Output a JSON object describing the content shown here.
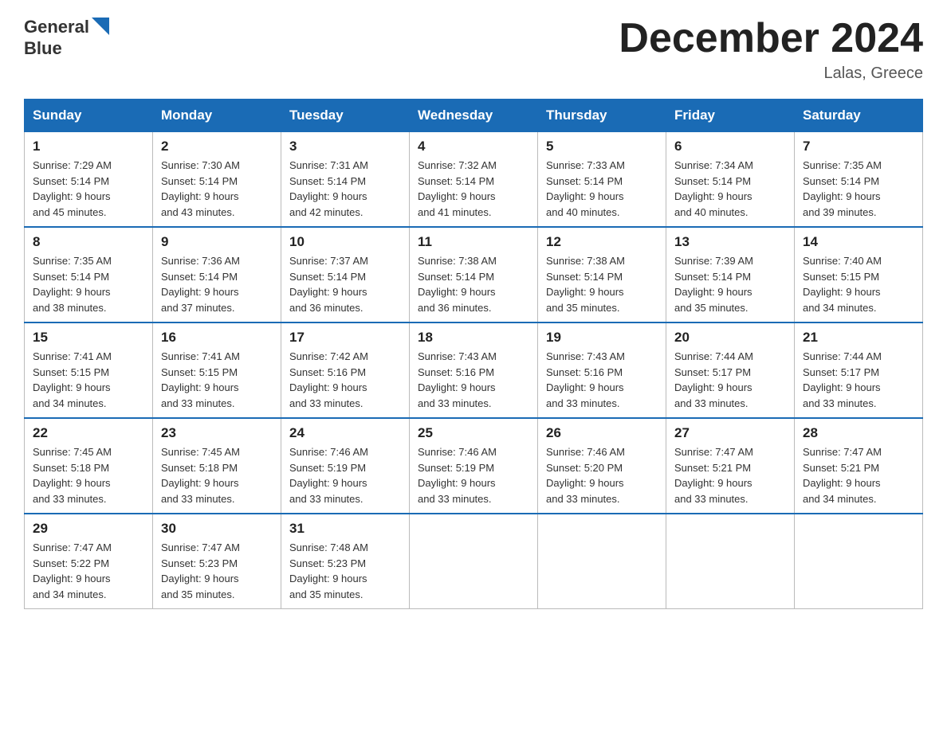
{
  "header": {
    "logo_line1": "General",
    "logo_line2": "Blue",
    "month_title": "December 2024",
    "location": "Lalas, Greece"
  },
  "weekdays": [
    "Sunday",
    "Monday",
    "Tuesday",
    "Wednesday",
    "Thursday",
    "Friday",
    "Saturday"
  ],
  "weeks": [
    [
      {
        "day": "1",
        "sunrise": "7:29 AM",
        "sunset": "5:14 PM",
        "daylight": "9 hours and 45 minutes."
      },
      {
        "day": "2",
        "sunrise": "7:30 AM",
        "sunset": "5:14 PM",
        "daylight": "9 hours and 43 minutes."
      },
      {
        "day": "3",
        "sunrise": "7:31 AM",
        "sunset": "5:14 PM",
        "daylight": "9 hours and 42 minutes."
      },
      {
        "day": "4",
        "sunrise": "7:32 AM",
        "sunset": "5:14 PM",
        "daylight": "9 hours and 41 minutes."
      },
      {
        "day": "5",
        "sunrise": "7:33 AM",
        "sunset": "5:14 PM",
        "daylight": "9 hours and 40 minutes."
      },
      {
        "day": "6",
        "sunrise": "7:34 AM",
        "sunset": "5:14 PM",
        "daylight": "9 hours and 40 minutes."
      },
      {
        "day": "7",
        "sunrise": "7:35 AM",
        "sunset": "5:14 PM",
        "daylight": "9 hours and 39 minutes."
      }
    ],
    [
      {
        "day": "8",
        "sunrise": "7:35 AM",
        "sunset": "5:14 PM",
        "daylight": "9 hours and 38 minutes."
      },
      {
        "day": "9",
        "sunrise": "7:36 AM",
        "sunset": "5:14 PM",
        "daylight": "9 hours and 37 minutes."
      },
      {
        "day": "10",
        "sunrise": "7:37 AM",
        "sunset": "5:14 PM",
        "daylight": "9 hours and 36 minutes."
      },
      {
        "day": "11",
        "sunrise": "7:38 AM",
        "sunset": "5:14 PM",
        "daylight": "9 hours and 36 minutes."
      },
      {
        "day": "12",
        "sunrise": "7:38 AM",
        "sunset": "5:14 PM",
        "daylight": "9 hours and 35 minutes."
      },
      {
        "day": "13",
        "sunrise": "7:39 AM",
        "sunset": "5:14 PM",
        "daylight": "9 hours and 35 minutes."
      },
      {
        "day": "14",
        "sunrise": "7:40 AM",
        "sunset": "5:15 PM",
        "daylight": "9 hours and 34 minutes."
      }
    ],
    [
      {
        "day": "15",
        "sunrise": "7:41 AM",
        "sunset": "5:15 PM",
        "daylight": "9 hours and 34 minutes."
      },
      {
        "day": "16",
        "sunrise": "7:41 AM",
        "sunset": "5:15 PM",
        "daylight": "9 hours and 33 minutes."
      },
      {
        "day": "17",
        "sunrise": "7:42 AM",
        "sunset": "5:16 PM",
        "daylight": "9 hours and 33 minutes."
      },
      {
        "day": "18",
        "sunrise": "7:43 AM",
        "sunset": "5:16 PM",
        "daylight": "9 hours and 33 minutes."
      },
      {
        "day": "19",
        "sunrise": "7:43 AM",
        "sunset": "5:16 PM",
        "daylight": "9 hours and 33 minutes."
      },
      {
        "day": "20",
        "sunrise": "7:44 AM",
        "sunset": "5:17 PM",
        "daylight": "9 hours and 33 minutes."
      },
      {
        "day": "21",
        "sunrise": "7:44 AM",
        "sunset": "5:17 PM",
        "daylight": "9 hours and 33 minutes."
      }
    ],
    [
      {
        "day": "22",
        "sunrise": "7:45 AM",
        "sunset": "5:18 PM",
        "daylight": "9 hours and 33 minutes."
      },
      {
        "day": "23",
        "sunrise": "7:45 AM",
        "sunset": "5:18 PM",
        "daylight": "9 hours and 33 minutes."
      },
      {
        "day": "24",
        "sunrise": "7:46 AM",
        "sunset": "5:19 PM",
        "daylight": "9 hours and 33 minutes."
      },
      {
        "day": "25",
        "sunrise": "7:46 AM",
        "sunset": "5:19 PM",
        "daylight": "9 hours and 33 minutes."
      },
      {
        "day": "26",
        "sunrise": "7:46 AM",
        "sunset": "5:20 PM",
        "daylight": "9 hours and 33 minutes."
      },
      {
        "day": "27",
        "sunrise": "7:47 AM",
        "sunset": "5:21 PM",
        "daylight": "9 hours and 33 minutes."
      },
      {
        "day": "28",
        "sunrise": "7:47 AM",
        "sunset": "5:21 PM",
        "daylight": "9 hours and 34 minutes."
      }
    ],
    [
      {
        "day": "29",
        "sunrise": "7:47 AM",
        "sunset": "5:22 PM",
        "daylight": "9 hours and 34 minutes."
      },
      {
        "day": "30",
        "sunrise": "7:47 AM",
        "sunset": "5:23 PM",
        "daylight": "9 hours and 35 minutes."
      },
      {
        "day": "31",
        "sunrise": "7:48 AM",
        "sunset": "5:23 PM",
        "daylight": "9 hours and 35 minutes."
      },
      null,
      null,
      null,
      null
    ]
  ],
  "labels": {
    "sunrise": "Sunrise:",
    "sunset": "Sunset:",
    "daylight": "Daylight:"
  }
}
